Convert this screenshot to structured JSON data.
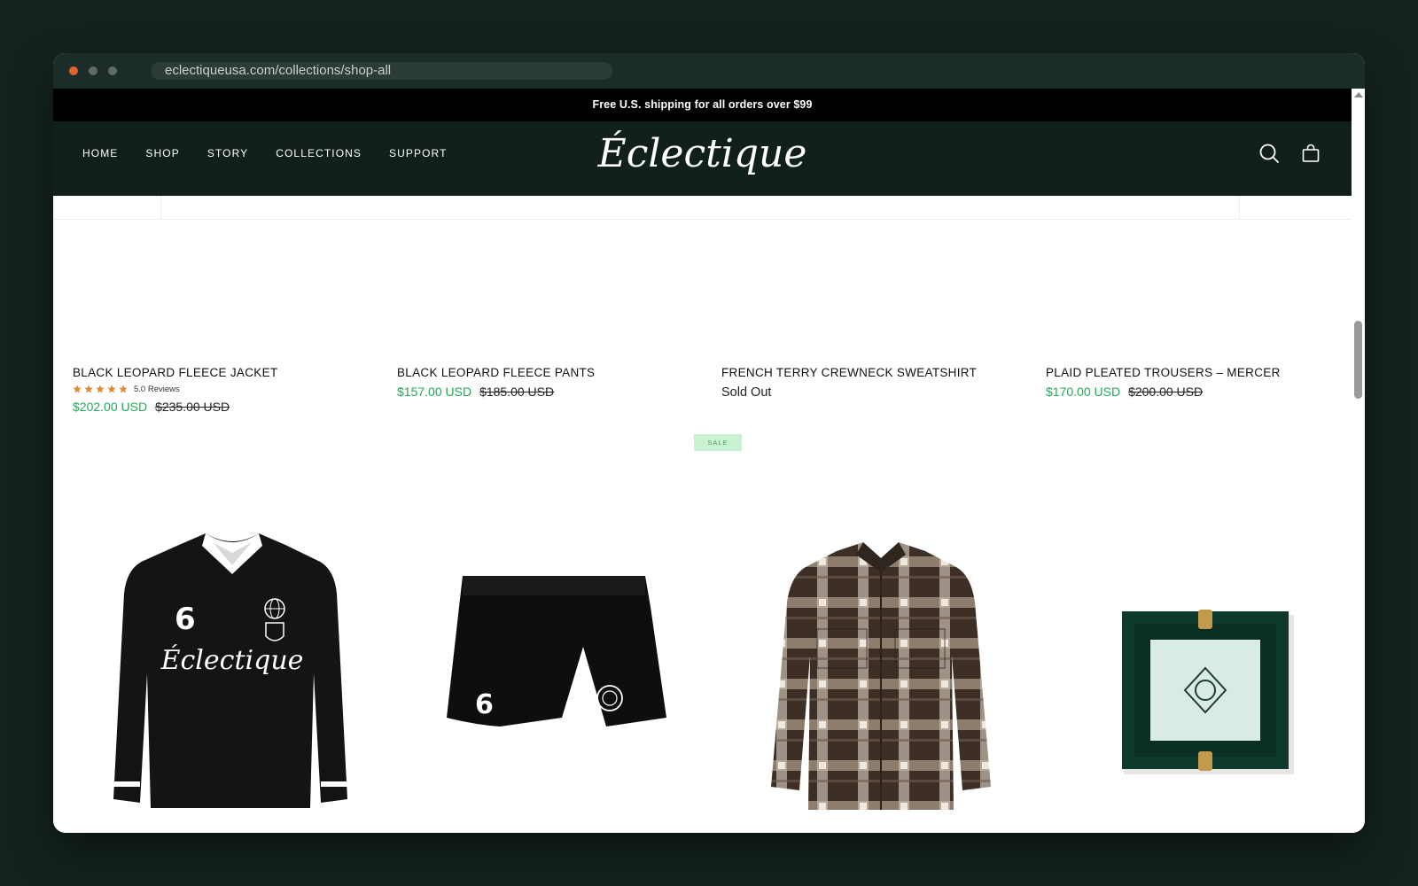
{
  "browser": {
    "url": "eclectiqueusa.com/collections/shop-all"
  },
  "announcement": "Free U.S. shipping for all orders over $99",
  "header": {
    "logo": "Éclectique",
    "nav": [
      {
        "label": "HOME"
      },
      {
        "label": "SHOP"
      },
      {
        "label": "STORY"
      },
      {
        "label": "COLLECTIONS"
      },
      {
        "label": "SUPPORT"
      }
    ],
    "icons": [
      "search-icon",
      "shopping-bag-icon"
    ]
  },
  "products_row1": [
    {
      "name": "BLACK LEOPARD FLEECE JACKET",
      "rating": 5,
      "reviews_label": "5.0 Reviews",
      "price": "$202.00 USD",
      "compare": "$235.00 USD"
    },
    {
      "name": "BLACK LEOPARD FLEECE PANTS",
      "price": "$157.00 USD",
      "compare": "$185.00 USD"
    },
    {
      "name": "FRENCH TERRY CREWNECK SWEATSHIRT",
      "status": "Sold Out"
    },
    {
      "name": "PLAID PLEATED TROUSERS – MERCER",
      "price": "$170.00 USD",
      "compare": "$200.00 USD"
    }
  ],
  "products_row2": [
    {
      "image": "black-soccer-jersey-image",
      "jersey_number": "6",
      "jersey_wordmark": "Éclectique",
      "badge": ""
    },
    {
      "image": "black-shorts-image",
      "shorts_number": "6",
      "badge": ""
    },
    {
      "image": "plaid-flannel-shirt-image",
      "badge": "SALE"
    },
    {
      "image": "green-ashtray-image",
      "badge": ""
    }
  ],
  "colors": {
    "price_green": "#23a75a",
    "header_bg": "#112019",
    "sale_badge_bg": "#c9f2d4",
    "star_orange": "#e08a2c"
  }
}
